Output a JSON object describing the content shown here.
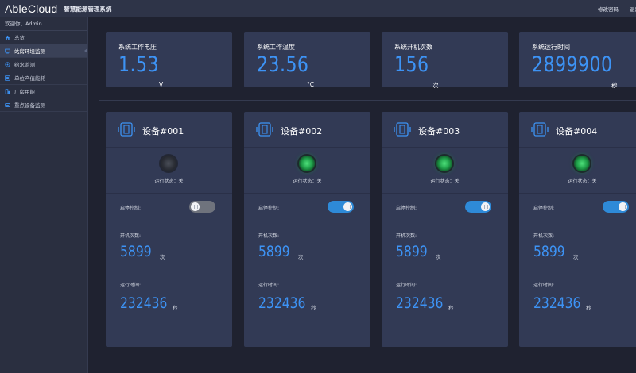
{
  "header": {
    "logo": "AbleCloud",
    "title": "智慧能源管理系统",
    "change_password": "修改密码",
    "logout": "退出"
  },
  "sidebar": {
    "welcome": "欢迎你，Admin",
    "items": [
      {
        "label": "总览",
        "icon": "home-icon"
      },
      {
        "label": "站房环境监测",
        "icon": "monitor-icon"
      },
      {
        "label": "给水监测",
        "icon": "water-icon"
      },
      {
        "label": "单位产值能耗",
        "icon": "energy-icon"
      },
      {
        "label": "厂房用能",
        "icon": "building-icon"
      },
      {
        "label": "重点设备监测",
        "icon": "device-icon"
      }
    ],
    "active_index": 1
  },
  "stats": [
    {
      "label": "系统工作电压",
      "value": "1.53",
      "unit": "V"
    },
    {
      "label": "系统工作温度",
      "value": "23.56",
      "unit": "°C"
    },
    {
      "label": "系统开机次数",
      "value": "156",
      "unit": "次"
    },
    {
      "label": "系统运行时间",
      "value": "2899900",
      "unit": "秒"
    }
  ],
  "devices": [
    {
      "title": "设备#001",
      "status_text": "运行状态：关",
      "lamp_on": false,
      "control_label": "启停控制:",
      "switch_on": false,
      "count_label": "开机次数:",
      "count": "5899",
      "count_unit": "次",
      "time_label": "运行时间:",
      "time": "232436",
      "time_unit": "秒"
    },
    {
      "title": "设备#002",
      "status_text": "运行状态：关",
      "lamp_on": true,
      "control_label": "启停控制:",
      "switch_on": true,
      "count_label": "开机次数:",
      "count": "5899",
      "count_unit": "次",
      "time_label": "运行时间:",
      "time": "232436",
      "time_unit": "秒"
    },
    {
      "title": "设备#003",
      "status_text": "运行状态：关",
      "lamp_on": true,
      "control_label": "启停控制:",
      "switch_on": true,
      "count_label": "开机次数:",
      "count": "5899",
      "count_unit": "次",
      "time_label": "运行时间:",
      "time": "232436",
      "time_unit": "秒"
    },
    {
      "title": "设备#004",
      "status_text": "运行状态：关",
      "lamp_on": true,
      "control_label": "启停控制:",
      "switch_on": true,
      "count_label": "开机次数:",
      "count": "5899",
      "count_unit": "次",
      "time_label": "运行时间:",
      "time": "232436",
      "time_unit": "秒"
    }
  ],
  "colors": {
    "accent": "#3d93f5",
    "card": "#323a55",
    "lamp_on": "#2fbf5c",
    "switch_on": "#2e8ad8"
  }
}
